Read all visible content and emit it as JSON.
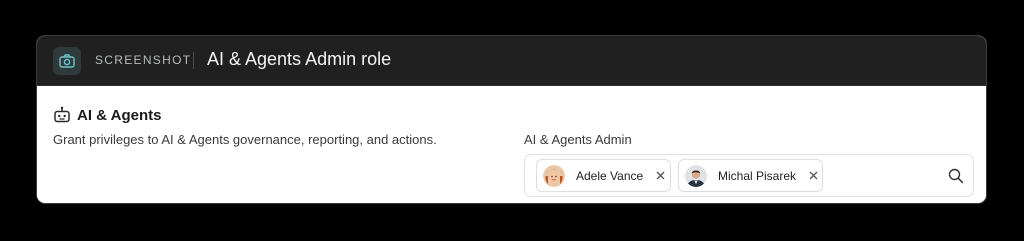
{
  "header": {
    "icon": "camera-icon",
    "kicker": "SCREENSHOT",
    "title": "AI & Agents Admin role"
  },
  "section": {
    "icon": "robot-icon",
    "title": "AI & Agents",
    "description": "Grant privileges to AI & Agents governance, reporting, and actions."
  },
  "assignment": {
    "label": "AI & Agents Admin",
    "users": [
      {
        "name": "Adele Vance",
        "avatar": "avatar-photo",
        "remove_icon": "close-icon"
      },
      {
        "name": "Michal Pisarek",
        "avatar": "avatar-photo",
        "remove_icon": "close-icon"
      }
    ],
    "search_icon": "search-icon"
  },
  "colors": {
    "page_background": "#000000",
    "header_background": "#202020",
    "icon_accent": "#6fc3c9",
    "body_background": "#ffffff"
  }
}
